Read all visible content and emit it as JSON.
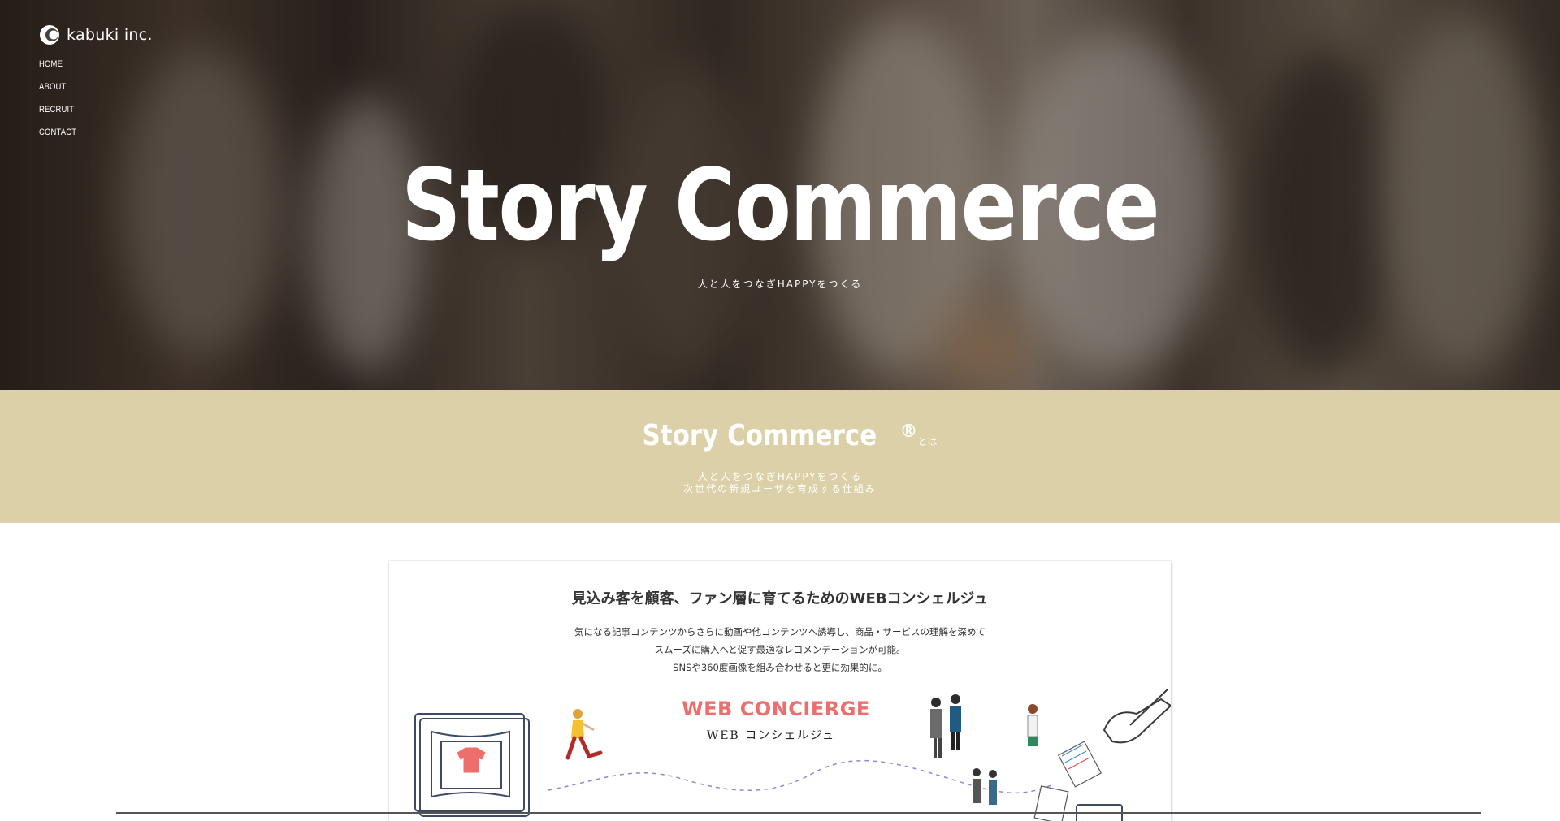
{
  "brand": {
    "name": "kabuki inc."
  },
  "nav": {
    "items": [
      {
        "label": "HOME"
      },
      {
        "label": "ABOUT"
      },
      {
        "label": "RECRUIT"
      },
      {
        "label": "CONTACT"
      }
    ]
  },
  "hero": {
    "title": "Story Commerce",
    "subtitle": "人と人をつなぎHAPPYをつくる"
  },
  "band": {
    "title": "Story Commerce",
    "registered": "®",
    "suffix": "とは",
    "line1": "人と人をつなぎHAPPYをつくる",
    "line2": "次世代の新規ユーザを育成する仕組み"
  },
  "card": {
    "title": "見込み客を顧客、ファン層に育てるためのWEBコンシェルジュ",
    "desc_line1": "気になる記事コンテンツからさらに動画や他コンテンツへ誘導し、商品・サービスの理解を深めて",
    "desc_line2": "スムーズに購入へと促す最適なレコメンデーションが可能。",
    "desc_line3": "SNSや360度画像を組み合わせると更に効果的に。",
    "illustration_title": "WEB CONCIERGE",
    "illustration_subtitle": "WEB コンシェルジュ"
  },
  "colors": {
    "band_bg": "#dcd0a8",
    "accent_red": "#ee6d6d",
    "text_dark": "#333333"
  }
}
